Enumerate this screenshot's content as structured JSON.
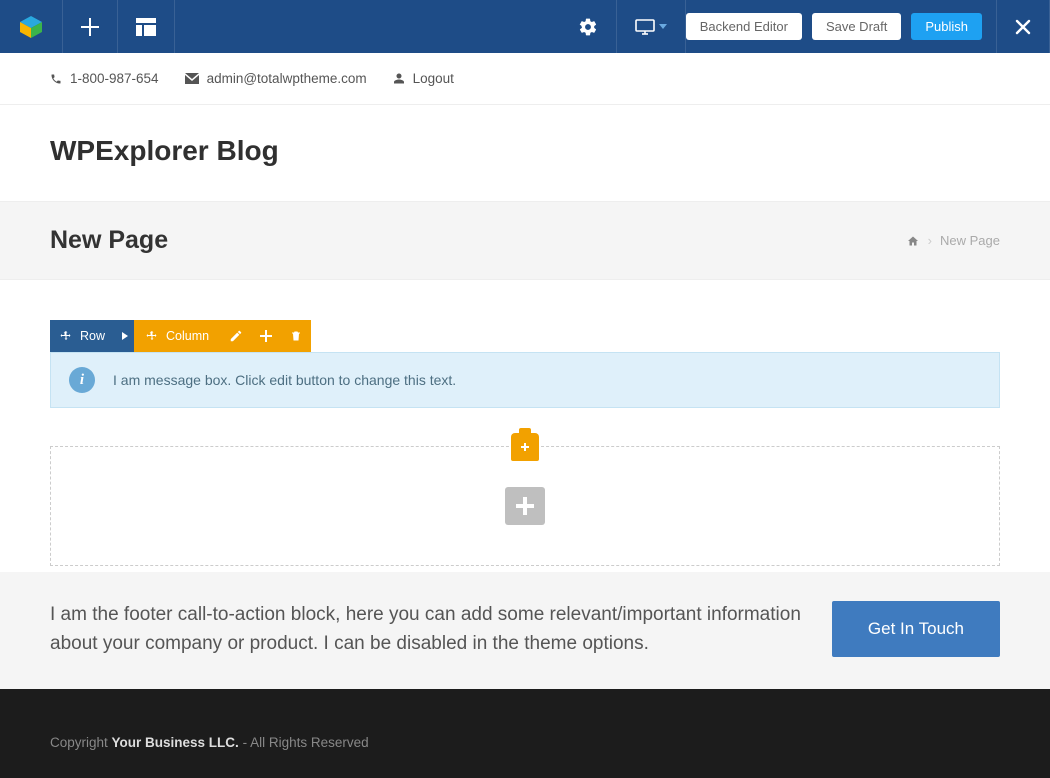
{
  "admin_bar": {
    "backend_editor": "Backend Editor",
    "save_draft": "Save Draft",
    "publish": "Publish"
  },
  "top_info": {
    "phone": "1-800-987-654",
    "email": "admin@totalwptheme.com",
    "logout": "Logout"
  },
  "site_title": "WPExplorer Blog",
  "page_header": {
    "title": "New Page",
    "breadcrumb_current": "New Page"
  },
  "editor_toolbar": {
    "row": "Row",
    "column": "Column"
  },
  "message_box": "I am message box. Click edit button to change this text.",
  "cta": {
    "text": "I am the footer call-to-action block, here you can add some relevant/important information about your company or product. I can be disabled in the theme options.",
    "button": "Get In Touch"
  },
  "footer": {
    "prefix": "Copyright ",
    "company": "Your Business LLC.",
    "suffix": " - All Rights Reserved"
  }
}
